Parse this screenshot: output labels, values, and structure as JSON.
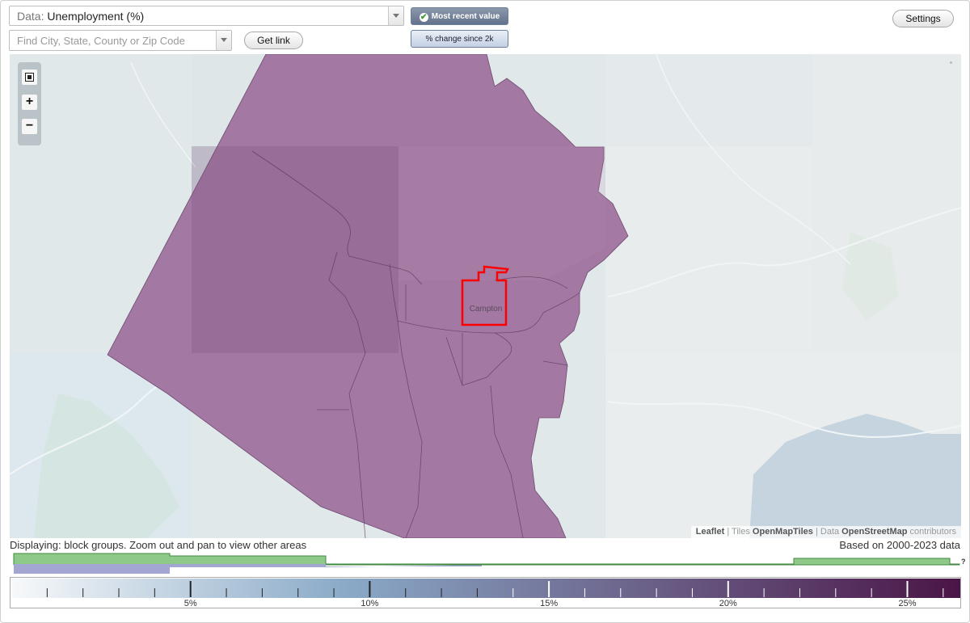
{
  "controls": {
    "data_prefix": "Data:",
    "data_value": "Unemployment (%)",
    "search_placeholder": "Find City, State, County or Zip Code",
    "get_link_label": "Get link",
    "most_recent_label": "Most recent value",
    "change_label": "% change since 2k",
    "settings_label": "Settings"
  },
  "map": {
    "place_label": "Campton",
    "attribution": {
      "leaflet": "Leaflet",
      "sep1": " | Tiles ",
      "tiles": "OpenMapTiles",
      "sep2": " | Data ",
      "data": "OpenStreetMap",
      "contributors": " contributors"
    },
    "zoom_fit_icon": "fit-bounds-icon",
    "zoom_in_label": "+",
    "zoom_out_label": "−"
  },
  "status": {
    "displaying": "Displaying: block groups. Zoom out and pan to view other areas",
    "based_on": "Based on 2000-2023 data",
    "histogram_help": "?"
  },
  "legend": {
    "tick_labels": [
      "5%",
      "10%",
      "15%",
      "20%",
      "25%"
    ],
    "tick_values": [
      5,
      10,
      15,
      20,
      25
    ],
    "min": 0,
    "max": 26.5,
    "color_low": "#f7f9fa",
    "color_mid": "#8aaac8",
    "color_high": "#4a1446"
  },
  "colors": {
    "region_fill": "#9d6f9c",
    "selected_outline": "#ff0000",
    "histogram_green": "#8ec98a",
    "histogram_blue": "#a3a6d2"
  }
}
